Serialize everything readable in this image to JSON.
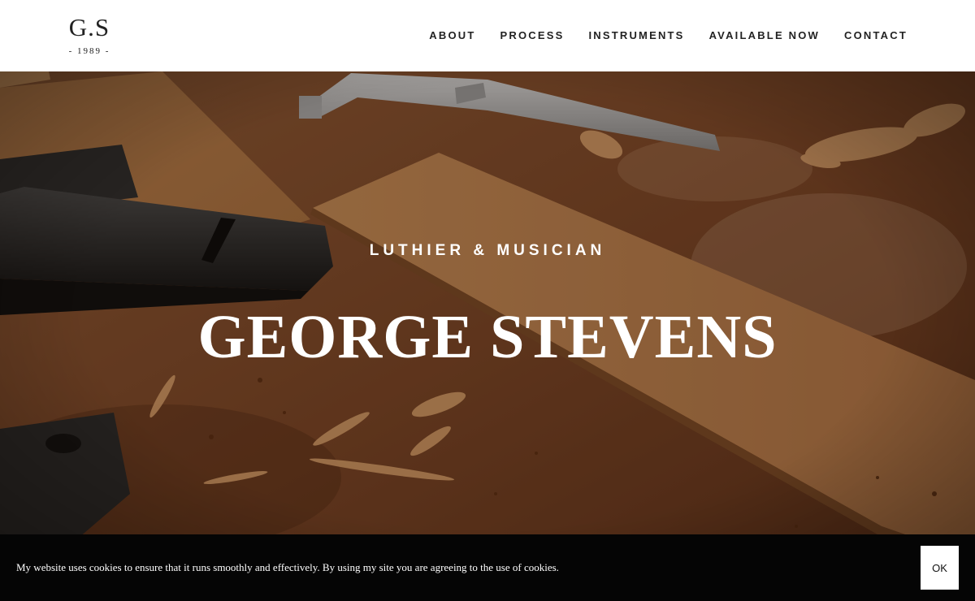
{
  "header": {
    "logo": {
      "mark": "G.S",
      "year": "- 1989 -"
    },
    "nav": [
      {
        "label": "ABOUT"
      },
      {
        "label": "PROCESS"
      },
      {
        "label": "INSTRUMENTS"
      },
      {
        "label": "AVAILABLE NOW"
      },
      {
        "label": "CONTACT"
      }
    ]
  },
  "hero": {
    "kicker": "LUTHIER & MUSICIAN",
    "title": "GEORGE STEVENS",
    "background": "workbench-with-tools-and-wood-shavings"
  },
  "cookie_banner": {
    "text": "My website uses cookies to ensure that it runs smoothly and effectively. By using my site you are agreeing to the use of cookies.",
    "button_label": "OK"
  },
  "colors": {
    "header_bg": "#ffffff",
    "nav_text": "#222222",
    "hero_text": "#ffffff",
    "banner_bg": "#050505",
    "wood": "#8a5530"
  }
}
